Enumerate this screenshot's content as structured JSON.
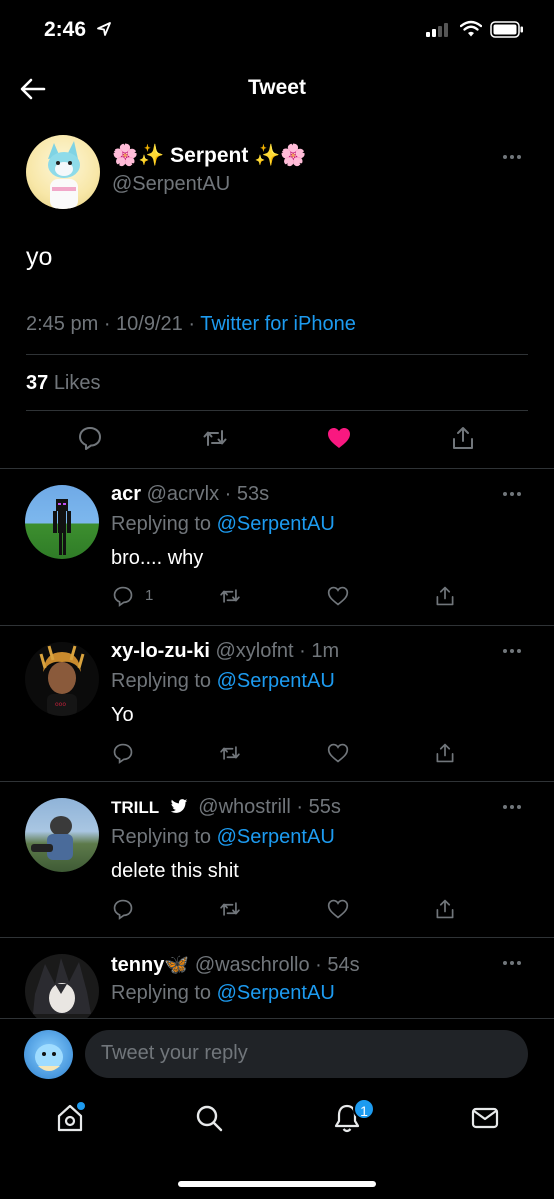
{
  "status_bar": {
    "time": "2:46"
  },
  "header": {
    "title": "Tweet"
  },
  "main_tweet": {
    "display_name": "🌸✨ Serpent ✨🌸",
    "handle": "@SerpentAU",
    "text": "yo",
    "time": "2:45 pm",
    "date": "10/9/21",
    "source": "Twitter for iPhone",
    "likes_count": "37",
    "likes_label": "Likes",
    "liked": true
  },
  "replies": [
    {
      "name": "acr",
      "handle": "@acrvlx",
      "age": "53s",
      "replying_prefix": "Replying to",
      "replying_to": "@SerpentAU",
      "text": "bro.... why",
      "reply_count": "1"
    },
    {
      "name": "xy-lo-zu-ki",
      "handle": "@xylofnt",
      "age": "1m",
      "replying_prefix": "Replying to",
      "replying_to": "@SerpentAU",
      "text": "Yo",
      "reply_count": ""
    },
    {
      "name": "TRILL",
      "handle": "@whostrill",
      "age": "55s",
      "replying_prefix": "Replying to",
      "replying_to": "@SerpentAU",
      "text": "delete this shit",
      "reply_count": ""
    },
    {
      "name": "tenny🦋",
      "handle": "@waschrollo",
      "age": "54s",
      "replying_prefix": "Replying to",
      "replying_to": "@SerpentAU",
      "text": "",
      "reply_count": ""
    }
  ],
  "composer": {
    "placeholder": "Tweet your reply"
  },
  "tab_bar": {
    "notifications_badge": "1"
  },
  "colors": {
    "accent": "#1d9bf0",
    "like": "#f91880",
    "background": "#000000",
    "muted": "#71767b"
  }
}
